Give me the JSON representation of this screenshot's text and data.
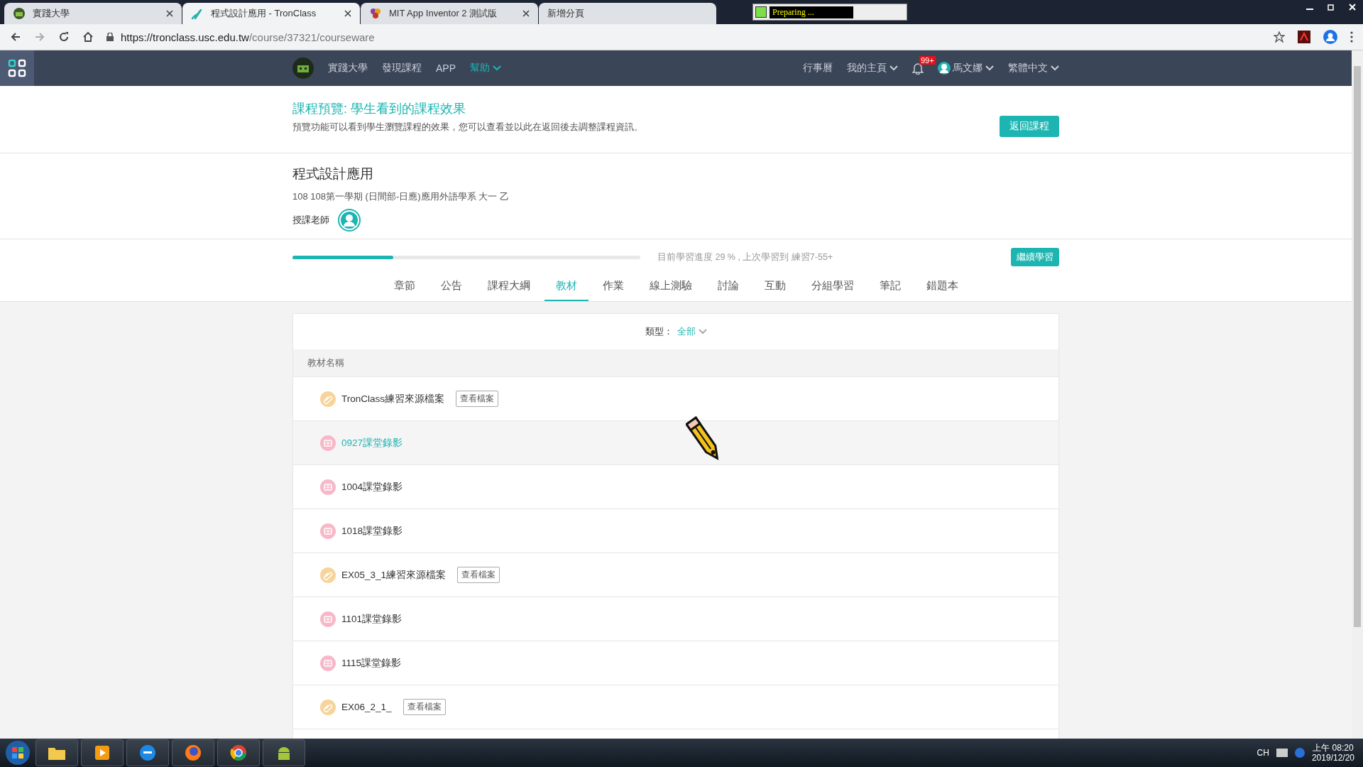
{
  "browser": {
    "tabs": [
      {
        "title": "實踐大學",
        "kind": "school",
        "selected": false
      },
      {
        "title": "程式設計應用 - TronClass",
        "kind": "tronclass",
        "selected": true
      },
      {
        "title": "MIT App Inventor 2 測試版",
        "kind": "mit",
        "selected": false
      },
      {
        "title": "新增分頁",
        "kind": "blank",
        "selected": false
      }
    ],
    "recorder_status": "Preparing ...",
    "url_host": "https://tronclass.usc.edu.tw",
    "url_path": "/course/37321/courseware"
  },
  "nav": {
    "left": [
      {
        "label": "實踐大學",
        "dropdown": false,
        "selected": false
      },
      {
        "label": "發現課程",
        "dropdown": false,
        "selected": false
      },
      {
        "label": "APP",
        "dropdown": false,
        "selected": false
      },
      {
        "label": "幫助",
        "dropdown": true,
        "selected": true
      }
    ],
    "right": [
      {
        "label": "行事曆",
        "dropdown": false
      },
      {
        "label": "我的主頁",
        "dropdown": true
      }
    ],
    "notifications": "99+",
    "user": "馬文娜",
    "language": "繁體中文"
  },
  "preview": {
    "title": "課程預覽: 學生看到的課程效果",
    "description": "預覽功能可以看到學生瀏覽課程的效果，您可以查看並以此在返回後去調整課程資訊。",
    "button": "返回課程"
  },
  "course": {
    "title": "程式設計應用",
    "term": "108 108第一學期 (日間部-日應)應用外語學系 大一 乙",
    "teacher_label": "授課老師"
  },
  "progress": {
    "level": 0.29,
    "text": "目前學習進度 29 % , 上次學習到 練習7-55+",
    "button": "繼續學習"
  },
  "tabs": [
    {
      "label": "章節",
      "selected": false
    },
    {
      "label": "公告",
      "selected": false
    },
    {
      "label": "課程大綱",
      "selected": false
    },
    {
      "label": "教材",
      "selected": true
    },
    {
      "label": "作業",
      "selected": false
    },
    {
      "label": "線上測驗",
      "selected": false
    },
    {
      "label": "討論",
      "selected": false
    },
    {
      "label": "互動",
      "selected": false
    },
    {
      "label": "分組學習",
      "selected": false
    },
    {
      "label": "筆記",
      "selected": false
    },
    {
      "label": "錯題本",
      "selected": false
    }
  ],
  "filter": {
    "label": "類型：",
    "value": "全部"
  },
  "table": {
    "column": "教材名稱",
    "rows": [
      {
        "kind": "file",
        "name": "TronClass練習來源檔案",
        "action": "查看檔案",
        "selected": false
      },
      {
        "kind": "video",
        "name": "0927課堂錄影",
        "selected": true
      },
      {
        "kind": "video",
        "name": "1004課堂錄影",
        "selected": false
      },
      {
        "kind": "video",
        "name": "1018課堂錄影",
        "selected": false
      },
      {
        "kind": "file",
        "name": "EX05_3_1練習來源檔案",
        "action": "查看檔案",
        "selected": false
      },
      {
        "kind": "video",
        "name": "1101課堂錄影",
        "selected": false
      },
      {
        "kind": "video",
        "name": "1115課堂錄影",
        "selected": false
      },
      {
        "kind": "file",
        "name": "EX06_2_1_",
        "action": "查看檔案",
        "selected": false
      }
    ]
  },
  "taskbar": {
    "language": "CH",
    "time": "上午 08:20",
    "date": "2019/12/20"
  }
}
